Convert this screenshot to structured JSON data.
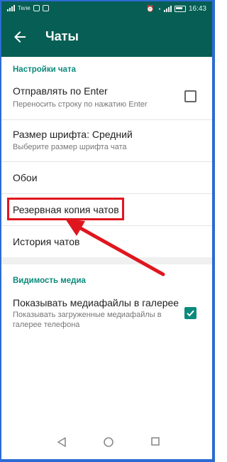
{
  "status_bar": {
    "carrier": "Теле",
    "time": "16:43"
  },
  "app_bar": {
    "title": "Чаты",
    "back_icon": "arrow-left-icon"
  },
  "sections": [
    {
      "header": "Настройки чата",
      "items": [
        {
          "title": "Отправлять по Enter",
          "subtitle": "Переносить строку по нажатию Enter",
          "checked": false
        },
        {
          "title": "Размер шрифта: Средний",
          "subtitle": "Выберите размер шрифта чата"
        },
        {
          "title": "Обои"
        },
        {
          "title": "Резервная копия чатов"
        },
        {
          "title": "История чатов"
        }
      ]
    },
    {
      "header": "Видимость медиа",
      "items": [
        {
          "title": "Показывать медиафайлы в галерее",
          "subtitle_line1": "Показывать загруженные медиафайлы в",
          "subtitle_line2": "галерее телефона",
          "checked": true
        }
      ]
    }
  ],
  "annotation": {
    "highlight_target": "Резервная копия чатов",
    "color": "#e0161e"
  },
  "nav_bar": {
    "back_icon": "triangle-back-icon",
    "home_icon": "circle-home-icon",
    "recents_icon": "square-recents-icon"
  },
  "colors": {
    "primary": "#075e54",
    "accent": "#0b8a7b",
    "frame": "#2c6bd3"
  }
}
